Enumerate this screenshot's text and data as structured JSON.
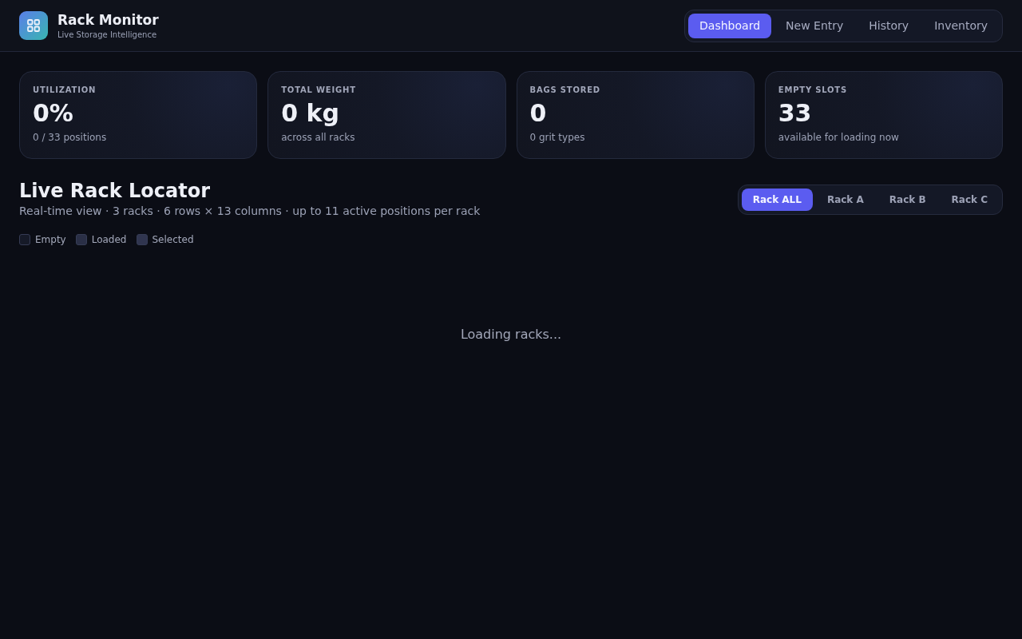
{
  "app": {
    "title": "Rack Monitor",
    "subtitle": "Live Storage Intelligence"
  },
  "nav": [
    {
      "label": "Dashboard",
      "selected": true
    },
    {
      "label": "New Entry",
      "selected": false
    },
    {
      "label": "History",
      "selected": false
    },
    {
      "label": "Inventory",
      "selected": false
    }
  ],
  "stats": [
    {
      "label": "UTILIZATION",
      "value": "0%",
      "note": "0 / 33 positions"
    },
    {
      "label": "TOTAL WEIGHT",
      "value": "0 kg",
      "note": "across all racks"
    },
    {
      "label": "BAGS STORED",
      "value": "0",
      "note": "0 grit types"
    },
    {
      "label": "EMPTY SLOTS",
      "value": "33",
      "note": "available for loading now"
    }
  ],
  "locator": {
    "title": "Live Rack Locator",
    "subtitle": "Real-time view · 3 racks · 6 rows × 13 columns · up to 11 active positions per rack",
    "rack_filters": [
      {
        "label": "Rack ALL",
        "selected": true
      },
      {
        "label": "Rack A",
        "selected": false
      },
      {
        "label": "Rack B",
        "selected": false
      },
      {
        "label": "Rack C",
        "selected": false
      }
    ],
    "legend": [
      {
        "label": "Empty",
        "color": "#161a28"
      },
      {
        "label": "Loaded",
        "color": "#2a2f46"
      },
      {
        "label": "Selected",
        "color": "#30354f"
      }
    ],
    "status": "Loading racks..."
  }
}
